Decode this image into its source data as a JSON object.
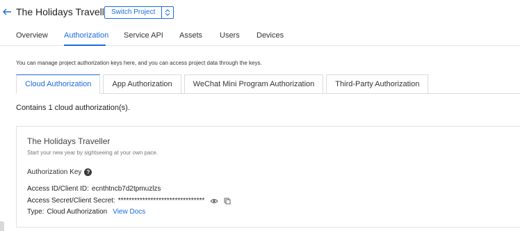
{
  "header": {
    "title": "The Holidays Traveller",
    "switch_label": "Switch Project"
  },
  "nav": {
    "tabs": [
      "Overview",
      "Authorization",
      "Service API",
      "Assets",
      "Users",
      "Devices"
    ],
    "active": "Authorization"
  },
  "intro": "You can manage project authorization keys here, and you can access project data through the keys.",
  "subtabs": [
    "Cloud Authorization",
    "App Authorization",
    "WeChat Mini Program Authorization",
    "Third-Party Authorization"
  ],
  "count_text": "Contains 1 cloud authorization(s).",
  "card": {
    "title": "The Holidays Traveller",
    "subtitle": "Start your new year by sightseeing at your own pace.",
    "key_label": "Authorization Key",
    "access_id_label": "Access ID/Client ID:",
    "access_id_value": "ecnthtncb7d2tpmuzlzs",
    "secret_label": "Access Secret/Client Secret:",
    "secret_value": "********************************",
    "type_label": "Type:",
    "type_value": "Cloud Authorization",
    "view_docs": "View Docs"
  },
  "colors": {
    "accent": "#1a6be0",
    "border": "#dcdcdc"
  },
  "icons": [
    "back-arrow-icon",
    "updown-arrows-icon",
    "question-icon",
    "eye-icon",
    "copy-icon"
  ]
}
